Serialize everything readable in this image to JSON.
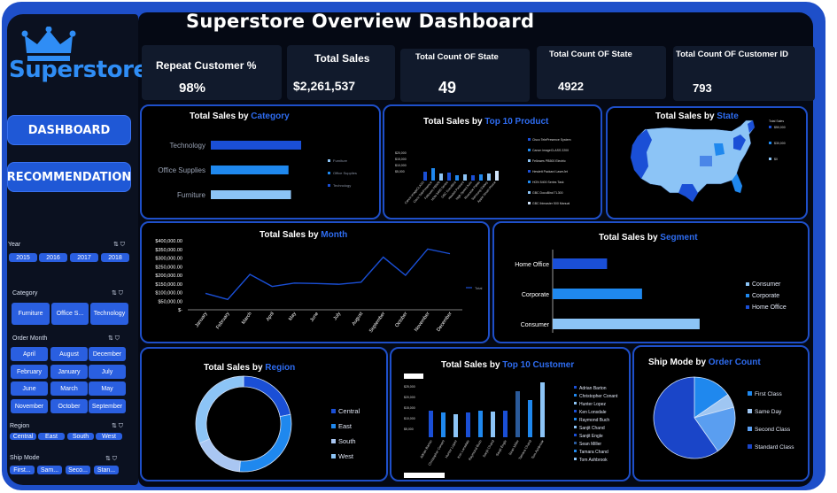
{
  "dashboard": {
    "title": "Superstore Overview Dashboard"
  },
  "logo": {
    "text": "Superstore"
  },
  "nav": {
    "dashboard": "DASHBOARD",
    "recommendation": "RECOMMENDATION"
  },
  "filters": {
    "year": {
      "label": "Year",
      "options": [
        "2015",
        "2016",
        "2017",
        "2018"
      ]
    },
    "category": {
      "label": "Category",
      "options": [
        "Furniture",
        "Office S...",
        "Technology"
      ]
    },
    "order_month": {
      "label": "Order Month",
      "options": [
        "April",
        "August",
        "December",
        "February",
        "January",
        "July",
        "June",
        "March",
        "May",
        "November",
        "October",
        "September"
      ]
    },
    "region": {
      "label": "Region",
      "options": [
        "Central",
        "East",
        "South",
        "West"
      ]
    },
    "ship_mode": {
      "label": "Ship Mode",
      "options": [
        "First...",
        "Sam...",
        "Seco...",
        "Stan..."
      ]
    }
  },
  "kpis": {
    "repeat": {
      "label": "Repeat Customer %",
      "value": "98%"
    },
    "sales": {
      "label": "Total Sales",
      "value": "$2,261,537"
    },
    "state_count": {
      "label": "Total Count OF State",
      "value": "49"
    },
    "state_count2": {
      "label": "Total Count OF State",
      "value": "4922"
    },
    "customer_id": {
      "label": "Total Count OF Customer ID",
      "value": "793"
    }
  },
  "panels": {
    "category": {
      "title_a": "Total Sales by ",
      "title_b": "Category"
    },
    "product": {
      "title_a": "Total Sales by ",
      "title_b": "Top 10 Product"
    },
    "state": {
      "title_a": "Total Sales by ",
      "title_b": "State"
    },
    "month": {
      "title_a": "Total Sales by ",
      "title_b": "Month"
    },
    "segment": {
      "title_a": "Total Sales by ",
      "title_b": "Segment"
    },
    "region": {
      "title_a": "Total Sales by ",
      "title_b": "Region"
    },
    "customer": {
      "title_a": "Total Sales by ",
      "title_b": "Top 10 Customer"
    },
    "shipmode": {
      "title_a": "Ship Mode by ",
      "title_b": "Order Count"
    }
  },
  "colors": {
    "frame": "#1e4fc9",
    "dark": "#1a4fd6",
    "mid": "#1f88ee",
    "light": "#8cc4f6",
    "accent": "#2e6cf0"
  },
  "chart_data": [
    {
      "id": "category",
      "type": "bar",
      "orientation": "horizontal",
      "categories": [
        "Technology",
        "Office Supplies",
        "Furniture"
      ],
      "values": [
        836154,
        719047,
        741999
      ],
      "legend": [
        "Furniture",
        "Office Supplies",
        "Technology"
      ],
      "xlim": [
        0,
        1000000
      ]
    },
    {
      "id": "month",
      "type": "line",
      "categories": [
        "January",
        "February",
        "March",
        "April",
        "May",
        "June",
        "July",
        "August",
        "September",
        "October",
        "November",
        "December"
      ],
      "values": [
        95000,
        60000,
        205000,
        135000,
        155000,
        152000,
        148000,
        160000,
        305000,
        200000,
        352000,
        325000
      ],
      "ytick_labels": [
        "$400,000.00",
        "$350,000.00",
        "$300,000.00",
        "$250,000.00",
        "$200,000.00",
        "$150,000.00",
        "$100,000.00",
        "$50,000.00",
        "$-"
      ],
      "ylim": [
        0,
        400000
      ],
      "legend": [
        "Total"
      ]
    },
    {
      "id": "segment",
      "type": "bar",
      "orientation": "horizontal",
      "categories": [
        "Home Office",
        "Corporate",
        "Consumer"
      ],
      "values": [
        429653,
        706146,
        1161401
      ],
      "legend": [
        "Consumer",
        "Corporate",
        "Home Office"
      ],
      "xlim": [
        0,
        1400000
      ]
    },
    {
      "id": "region",
      "type": "pie",
      "labels": [
        "Central",
        "East",
        "South",
        "West"
      ],
      "values": [
        501240,
        678781,
        391722,
        725458
      ]
    },
    {
      "id": "shipmode",
      "type": "pie",
      "labels": [
        "First Class",
        "Same Day",
        "Second Class",
        "Standard Class"
      ],
      "values": [
        1538,
        543,
        1945,
        5968
      ]
    }
  ]
}
